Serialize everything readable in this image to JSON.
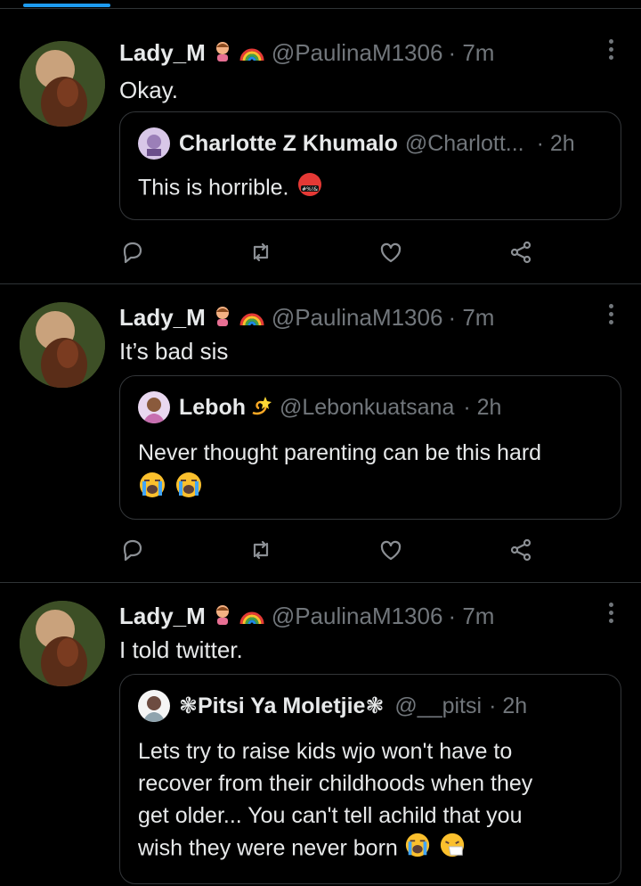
{
  "tweets": [
    {
      "name": "Lady_M",
      "handle": "@PaulinaM1306",
      "time": "· 7m",
      "text": "Okay.",
      "quote": {
        "name": "Charlotte Z Khumalo",
        "handle": "@Charlott...",
        "time": "· 2h",
        "lines": [
          "This is horrible."
        ]
      }
    },
    {
      "name": "Lady_M",
      "handle": "@PaulinaM1306",
      "time": "· 7m",
      "text": "It’s bad sis",
      "quote": {
        "name": "Leboh",
        "handle": "@Lebonkuatsana",
        "time": "· 2h",
        "lines": [
          "Never thought parenting can be this hard"
        ]
      }
    },
    {
      "name": "Lady_M",
      "handle": "@PaulinaM1306",
      "time": "· 7m",
      "text": "I told twitter.",
      "quote": {
        "name": "❃Pitsi Ya Moletjie❃",
        "handle": "@__pitsi",
        "time": "· 2h",
        "lines": [
          "Lets try to raise kids wjo won't have to",
          "recover from their childhoods when they",
          "get older... You can't tell achild that you",
          "wish they were never born"
        ]
      }
    }
  ],
  "icons": {
    "actions": [
      "reply-icon",
      "retweet-icon",
      "like-icon",
      "share-icon"
    ],
    "more": "more-icon"
  },
  "colors": {
    "accent": "#1d9bf0",
    "muted": "#71767b",
    "background": "#000000"
  }
}
